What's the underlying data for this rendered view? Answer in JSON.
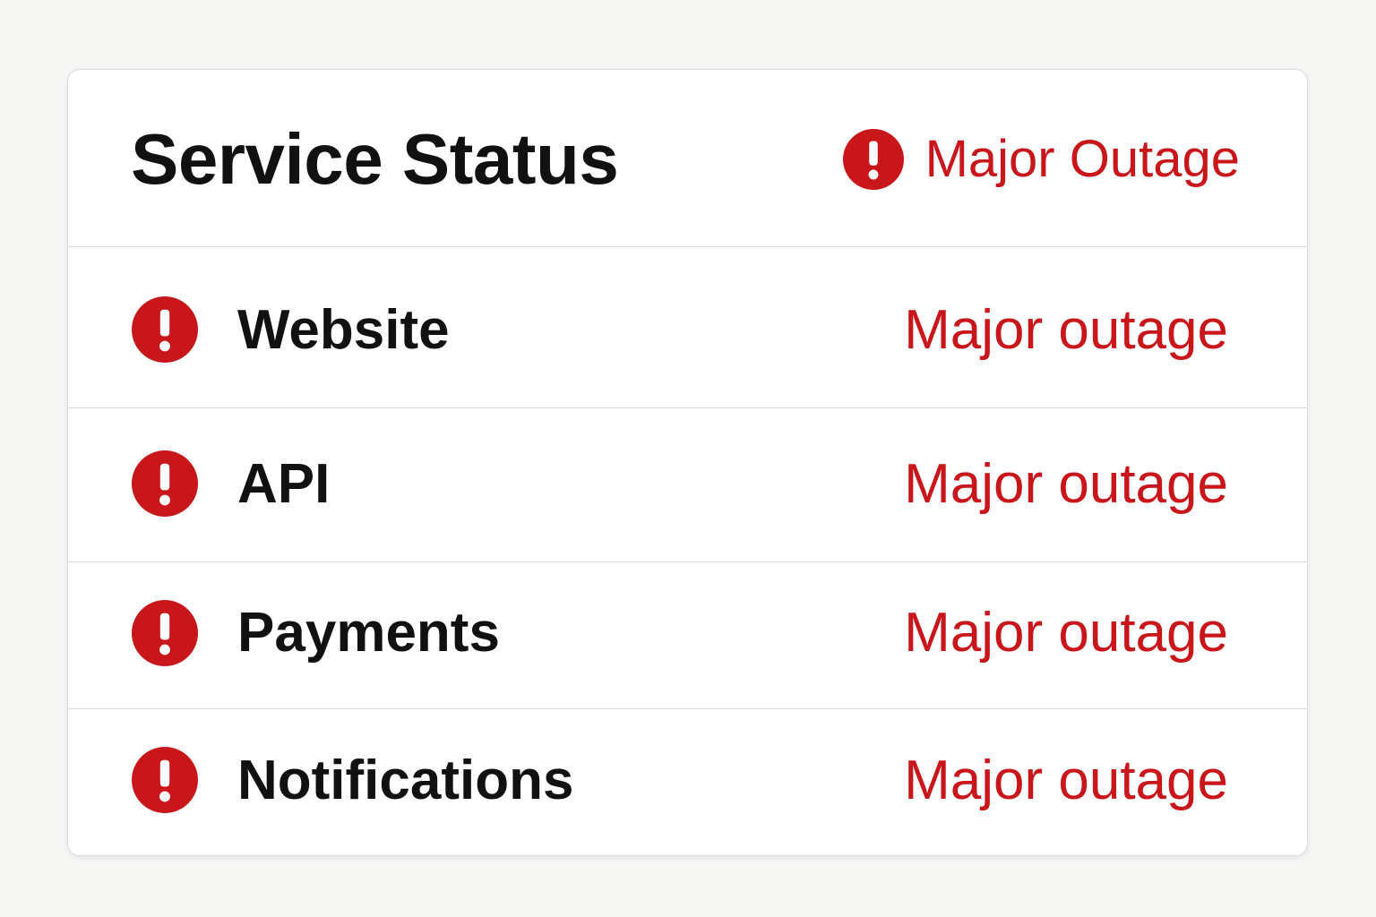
{
  "header": {
    "title": "Service Status",
    "overall_status": "Major Outage",
    "overall_icon": "alert-circle-icon"
  },
  "colors": {
    "outage": "#c8161b",
    "text": "#111111",
    "background": "#f6f6f5",
    "card": "#ffffff",
    "divider": "#d9d9d9"
  },
  "services": [
    {
      "name": "Website",
      "status": "Major outage",
      "icon": "alert-circle-icon"
    },
    {
      "name": "API",
      "status": "Major outage",
      "icon": "alert-circle-icon"
    },
    {
      "name": "Payments",
      "status": "Major outage",
      "icon": "alert-circle-icon"
    },
    {
      "name": "Notifications",
      "status": "Major outage",
      "icon": "alert-circle-icon"
    }
  ]
}
